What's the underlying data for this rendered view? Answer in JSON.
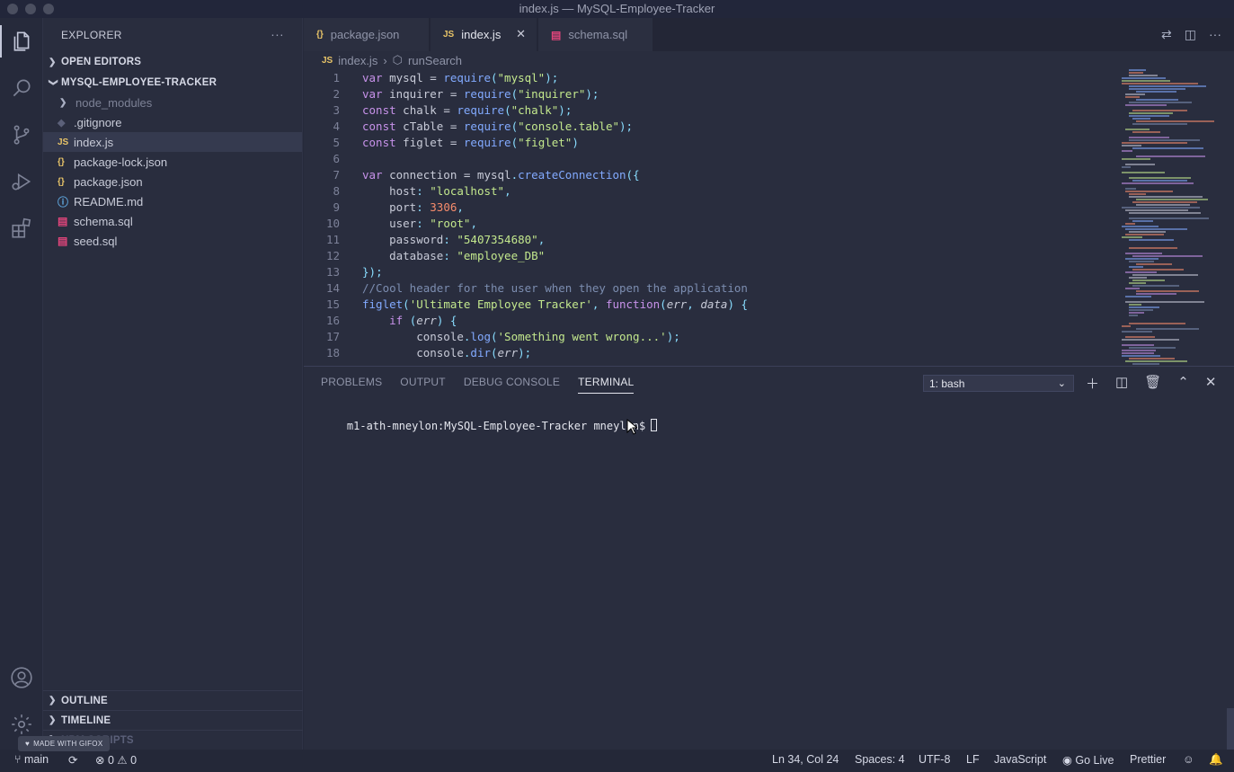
{
  "window": {
    "title": "index.js — MySQL-Employee-Tracker"
  },
  "explorer": {
    "header": "EXPLORER",
    "more_icon": "ellipsis-icon",
    "open_editors": "OPEN EDITORS",
    "project": "MYSQL-EMPLOYEE-TRACKER",
    "files": [
      {
        "name": "node_modules",
        "icon": "chevron-right-icon"
      },
      {
        "name": ".gitignore",
        "icon": "diamond-icon"
      },
      {
        "name": "index.js",
        "icon": "JS"
      },
      {
        "name": "package-lock.json",
        "icon": "{}"
      },
      {
        "name": "package.json",
        "icon": "{}"
      },
      {
        "name": "README.md",
        "icon": "info-icon"
      },
      {
        "name": "schema.sql",
        "icon": "database-icon"
      },
      {
        "name": "seed.sql",
        "icon": "database-icon"
      }
    ],
    "outline": "OUTLINE",
    "timeline": "TIMELINE",
    "npm_scripts": "NPM SCRIPTS"
  },
  "tabs": [
    {
      "label": "package.json",
      "icon": "{}"
    },
    {
      "label": "index.js",
      "icon": "JS"
    },
    {
      "label": "schema.sql",
      "icon": "database-icon"
    }
  ],
  "breadcrumbs": {
    "file": "index.js",
    "symbol": "runSearch",
    "file_icon": "JS"
  },
  "code": {
    "line_numbers": [
      "1",
      "2",
      "3",
      "4",
      "5",
      "6",
      "7",
      "8",
      "9",
      "10",
      "11",
      "12",
      "13",
      "14",
      "15",
      "16",
      "17",
      "18"
    ],
    "lines": [
      "var mysql = require(\"mysql\");",
      "var inquirer = require(\"inquirer\");",
      "const chalk = require(\"chalk\");",
      "const cTable = require(\"console.table\");",
      "const figlet = require(\"figlet\")",
      "",
      "var connection = mysql.createConnection({",
      "    host: \"localhost\",",
      "    port: 3306,",
      "    user: \"root\",",
      "    password: \"5407354680\",",
      "    database: \"employee_DB\"",
      "});",
      "//Cool header for the user when they open the application",
      "figlet('Ultimate Employee Tracker', function(err, data) {",
      "    if (err) {",
      "        console.log('Something went wrong...');",
      "        console.dir(err);"
    ]
  },
  "panel": {
    "tabs": [
      "PROBLEMS",
      "OUTPUT",
      "DEBUG CONSOLE",
      "TERMINAL"
    ],
    "terminal_select": "1: bash",
    "prompt": "m1-ath-mneylon:MySQL-Employee-Tracker mneylon$"
  },
  "status": {
    "branch": "main",
    "errors": "0",
    "warnings": "0",
    "position": "Ln 34, Col 24",
    "spaces": "Spaces: 4",
    "encoding": "UTF-8",
    "eol": "LF",
    "language": "JavaScript",
    "golive": "Go Live",
    "prettier": "Prettier"
  },
  "watermark": "MADE WITH GIFOX",
  "colors": {
    "background": "#292d3e",
    "keyword": "#c792ea",
    "function": "#82aaff",
    "string": "#c3e88d",
    "number": "#f78c6c",
    "comment": "#7c8db0"
  }
}
